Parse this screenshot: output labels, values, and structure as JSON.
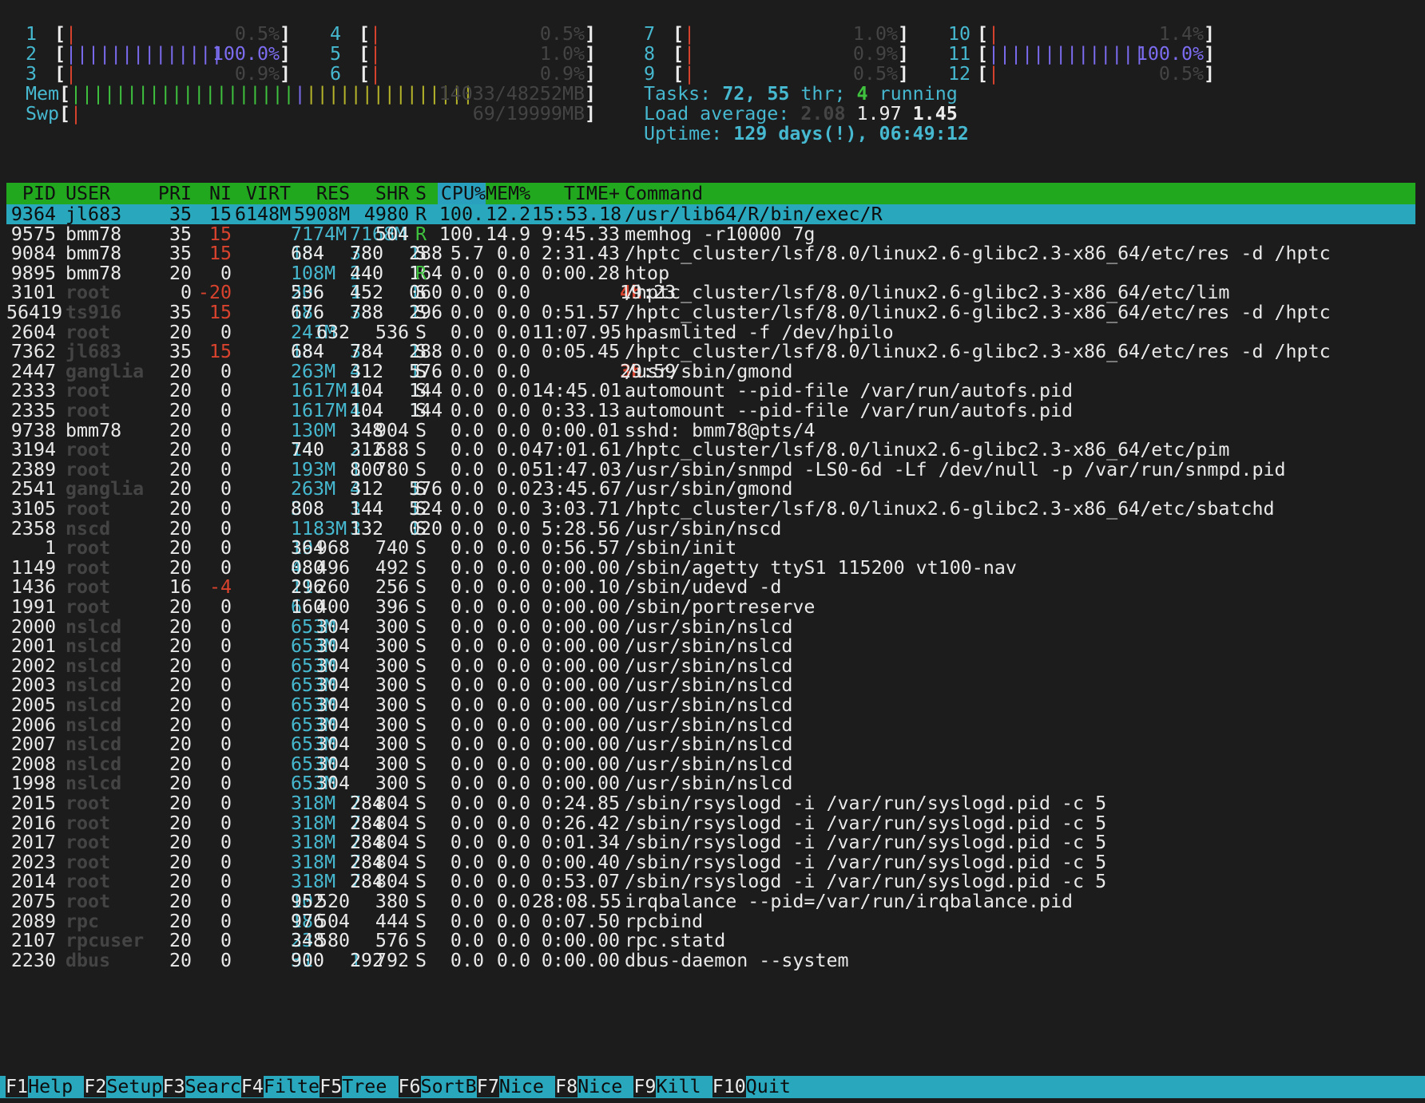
{
  "cpus": [
    {
      "id": "1",
      "pct": "0.5%",
      "fill": "|"
    },
    {
      "id": "2",
      "pct": "100.0%",
      "fill": "||||||||||||||"
    },
    {
      "id": "3",
      "pct": "0.9%",
      "fill": "|"
    },
    {
      "id": "4",
      "pct": "0.5%",
      "fill": "|"
    },
    {
      "id": "5",
      "pct": "1.0%",
      "fill": "|"
    },
    {
      "id": "6",
      "pct": "0.9%",
      "fill": "|"
    },
    {
      "id": "7",
      "pct": "1.0%",
      "fill": "|"
    },
    {
      "id": "8",
      "pct": "0.9%",
      "fill": "|"
    },
    {
      "id": "9",
      "pct": "0.5%",
      "fill": "|"
    },
    {
      "id": "10",
      "pct": "1.4%",
      "fill": "|"
    },
    {
      "id": "11",
      "pct": "100.0%",
      "fill": "||||||||||||||"
    },
    {
      "id": "12",
      "pct": "0.5%",
      "fill": "|"
    }
  ],
  "mem": {
    "label": "Mem",
    "value": "14033/48252MB",
    "fill_green": "||||||||||||||||||||",
    "fill_blue": "|",
    "fill_yellow": "|||||||||||||||"
  },
  "swp": {
    "label": "Swp",
    "value": "69/19999MB",
    "fill": "|"
  },
  "tasks": {
    "label": "Tasks: ",
    "tasks": "72",
    "sep": ", ",
    "threads": "55",
    "thr": " thr; ",
    "running": "4",
    "running_label": " running"
  },
  "load": {
    "label": "Load average: ",
    "l1": "2.08",
    "l5": "1.97",
    "l15": "1.45"
  },
  "uptime": {
    "label": "Uptime: ",
    "value": "129 days(!), 06:49:12"
  },
  "columns": [
    "PID",
    "USER",
    "PRI",
    "NI",
    "VIRT",
    "RES",
    "SHR",
    "S",
    "CPU%",
    "MEM%",
    "TIME+",
    "Command"
  ],
  "processes": [
    [
      "9364",
      "jl683",
      "35",
      "15",
      "6148M",
      "5908M",
      "4980",
      "R",
      "100.",
      "12.2",
      "15:53.18",
      "/usr/lib64/R/bin/exec/R"
    ],
    [
      "9575",
      "bmm78",
      "35",
      "15",
      "7174M",
      "7168M",
      "504",
      "R",
      "100.",
      "14.9",
      "9:45.33",
      "memhog -r10000 7g"
    ],
    [
      "9084",
      "bmm78",
      "35",
      "15",
      "18684",
      "3780",
      "1288",
      "S",
      "5.7",
      "0.0",
      "2:31.43",
      "/hptc_cluster/lsf/8.0/linux2.6-glibc2.3-x86_64/etc/res -d /hptc"
    ],
    [
      "9895",
      "bmm78",
      "20",
      "0",
      "108M",
      "2440",
      "1164",
      "R",
      "0.0",
      "0.0",
      "0:00.28",
      "htop"
    ],
    [
      "3101",
      "root",
      "0",
      "-20",
      "20536",
      "1452",
      "1060",
      "S",
      "0.0",
      "0.0",
      "4h19:23",
      "/hptc_cluster/lsf/8.0/linux2.6-glibc2.3-x86_64/etc/lim"
    ],
    [
      "56419",
      "ts916",
      "35",
      "15",
      "18676",
      "3788",
      "1296",
      "S",
      "0.0",
      "0.0",
      "0:51.57",
      "/hptc_cluster/lsf/8.0/linux2.6-glibc2.3-x86_64/etc/res -d /hptc"
    ],
    [
      "2604",
      "root",
      "20",
      "0",
      "241M",
      "632",
      "536",
      "S",
      "0.0",
      "0.0",
      "11:07.95",
      "hpasmlited -f /dev/hpilo"
    ],
    [
      "7362",
      "jl683",
      "35",
      "15",
      "18684",
      "3784",
      "1288",
      "S",
      "0.0",
      "0.0",
      "0:05.45",
      "/hptc_cluster/lsf/8.0/linux2.6-glibc2.3-x86_64/etc/res -d /hptc"
    ],
    [
      "2447",
      "ganglia",
      "20",
      "0",
      "263M",
      "4312",
      "1576",
      "S",
      "0.0",
      "0.0",
      "3h29:59",
      "/usr/sbin/gmond"
    ],
    [
      "2333",
      "root",
      "20",
      "0",
      "1617M",
      "4104",
      "1144",
      "S",
      "0.0",
      "0.0",
      "14:45.01",
      "automount --pid-file /var/run/autofs.pid"
    ],
    [
      "2335",
      "root",
      "20",
      "0",
      "1617M",
      "4104",
      "1144",
      "S",
      "0.0",
      "0.0",
      "0:33.13",
      "automount --pid-file /var/run/autofs.pid"
    ],
    [
      "9738",
      "bmm78",
      "20",
      "0",
      "130M",
      "3348",
      "904",
      "S",
      "0.0",
      "0.0",
      "0:00.01",
      "sshd: bmm78@pts/4"
    ],
    [
      "3194",
      "root",
      "20",
      "0",
      "14740",
      "2312",
      "688",
      "S",
      "0.0",
      "0.0",
      "47:01.61",
      "/hptc_cluster/lsf/8.0/linux2.6-glibc2.3-x86_64/etc/pim"
    ],
    [
      "2389",
      "root",
      "20",
      "0",
      "193M",
      "1800",
      "780",
      "S",
      "0.0",
      "0.0",
      "51:47.03",
      "/usr/sbin/snmpd -LS0-6d -Lf /dev/null -p /var/run/snmpd.pid"
    ],
    [
      "2541",
      "ganglia",
      "20",
      "0",
      "263M",
      "4312",
      "1576",
      "S",
      "0.0",
      "0.0",
      "23:45.67",
      "/usr/sbin/gmond"
    ],
    [
      "3105",
      "root",
      "20",
      "0",
      "30808",
      "3144",
      "1524",
      "S",
      "0.0",
      "0.0",
      "3:03.71",
      "/hptc_cluster/lsf/8.0/linux2.6-glibc2.3-x86_64/etc/sbatchd"
    ],
    [
      "2358",
      "nscd",
      "20",
      "0",
      "1183M",
      "3132",
      "1020",
      "S",
      "0.0",
      "0.0",
      "5:28.56",
      "/usr/sbin/nscd"
    ],
    [
      "1",
      "root",
      "20",
      "0",
      "19364",
      "968",
      "740",
      "S",
      "0.0",
      "0.0",
      "0:56.57",
      "/sbin/init"
    ],
    [
      "1149",
      "root",
      "20",
      "0",
      "4080",
      "496",
      "492",
      "S",
      "0.0",
      "0.0",
      "0:00.00",
      "/sbin/agetty ttyS1 115200 vt100-nav"
    ],
    [
      "1436",
      "root",
      "16",
      "-4",
      "11296",
      "260",
      "256",
      "S",
      "0.0",
      "0.0",
      "0:00.10",
      "/sbin/udevd -d"
    ],
    [
      "1991",
      "root",
      "20",
      "0",
      "6160",
      "400",
      "396",
      "S",
      "0.0",
      "0.0",
      "0:00.00",
      "/sbin/portreserve"
    ],
    [
      "2000",
      "nslcd",
      "20",
      "0",
      "653M",
      "304",
      "300",
      "S",
      "0.0",
      "0.0",
      "0:00.00",
      "/usr/sbin/nslcd"
    ],
    [
      "2001",
      "nslcd",
      "20",
      "0",
      "653M",
      "304",
      "300",
      "S",
      "0.0",
      "0.0",
      "0:00.00",
      "/usr/sbin/nslcd"
    ],
    [
      "2002",
      "nslcd",
      "20",
      "0",
      "653M",
      "304",
      "300",
      "S",
      "0.0",
      "0.0",
      "0:00.00",
      "/usr/sbin/nslcd"
    ],
    [
      "2003",
      "nslcd",
      "20",
      "0",
      "653M",
      "304",
      "300",
      "S",
      "0.0",
      "0.0",
      "0:00.00",
      "/usr/sbin/nslcd"
    ],
    [
      "2005",
      "nslcd",
      "20",
      "0",
      "653M",
      "304",
      "300",
      "S",
      "0.0",
      "0.0",
      "0:00.00",
      "/usr/sbin/nslcd"
    ],
    [
      "2006",
      "nslcd",
      "20",
      "0",
      "653M",
      "304",
      "300",
      "S",
      "0.0",
      "0.0",
      "0:00.00",
      "/usr/sbin/nslcd"
    ],
    [
      "2007",
      "nslcd",
      "20",
      "0",
      "653M",
      "304",
      "300",
      "S",
      "0.0",
      "0.0",
      "0:00.00",
      "/usr/sbin/nslcd"
    ],
    [
      "2008",
      "nslcd",
      "20",
      "0",
      "653M",
      "304",
      "300",
      "S",
      "0.0",
      "0.0",
      "0:00.00",
      "/usr/sbin/nslcd"
    ],
    [
      "1998",
      "nslcd",
      "20",
      "0",
      "653M",
      "304",
      "300",
      "S",
      "0.0",
      "0.0",
      "0:00.00",
      "/usr/sbin/nslcd"
    ],
    [
      "2015",
      "root",
      "20",
      "0",
      "318M",
      "7284",
      "804",
      "S",
      "0.0",
      "0.0",
      "0:24.85",
      "/sbin/rsyslogd -i /var/run/syslogd.pid -c 5"
    ],
    [
      "2016",
      "root",
      "20",
      "0",
      "318M",
      "7284",
      "804",
      "S",
      "0.0",
      "0.0",
      "0:26.42",
      "/sbin/rsyslogd -i /var/run/syslogd.pid -c 5"
    ],
    [
      "2017",
      "root",
      "20",
      "0",
      "318M",
      "7284",
      "804",
      "S",
      "0.0",
      "0.0",
      "0:01.34",
      "/sbin/rsyslogd -i /var/run/syslogd.pid -c 5"
    ],
    [
      "2023",
      "root",
      "20",
      "0",
      "318M",
      "7284",
      "804",
      "S",
      "0.0",
      "0.0",
      "0:00.40",
      "/sbin/rsyslogd -i /var/run/syslogd.pid -c 5"
    ],
    [
      "2014",
      "root",
      "20",
      "0",
      "318M",
      "7284",
      "804",
      "S",
      "0.0",
      "0.0",
      "0:53.07",
      "/sbin/rsyslogd -i /var/run/syslogd.pid -c 5"
    ],
    [
      "2075",
      "root",
      "20",
      "0",
      "10952",
      "520",
      "380",
      "S",
      "0.0",
      "0.0",
      "28:08.55",
      "irqbalance --pid=/var/run/irqbalance.pid"
    ],
    [
      "2089",
      "rpc",
      "20",
      "0",
      "18976",
      "504",
      "444",
      "S",
      "0.0",
      "0.0",
      "0:07.50",
      "rpcbind"
    ],
    [
      "2107",
      "rpcuser",
      "20",
      "0",
      "23348",
      "580",
      "576",
      "S",
      "0.0",
      "0.0",
      "0:00.00",
      "rpc.statd"
    ],
    [
      "2230",
      "dbus",
      "20",
      "0",
      "31900",
      "1292",
      "792",
      "S",
      "0.0",
      "0.0",
      "0:00.00",
      "dbus-daemon --system"
    ]
  ],
  "fkeys": [
    {
      "key": "F1",
      "label": "Help  "
    },
    {
      "key": "F2",
      "label": "Setup "
    },
    {
      "key": "F3",
      "label": "Search"
    },
    {
      "key": "F4",
      "label": "Filter"
    },
    {
      "key": "F5",
      "label": "Tree  "
    },
    {
      "key": "F6",
      "label": "SortBy"
    },
    {
      "key": "F7",
      "label": "Nice -"
    },
    {
      "key": "F8",
      "label": "Nice +"
    },
    {
      "key": "F9",
      "label": "Kill  "
    },
    {
      "key": "F10",
      "label": "Quit  "
    }
  ],
  "colors": {
    "background": "#1c1c1c",
    "header": "#22a81f",
    "selected": "#29a7bd",
    "cyan": "#46b8cf",
    "red": "#d9432e",
    "green": "#3fc33f",
    "blue": "#7b6cf0"
  }
}
